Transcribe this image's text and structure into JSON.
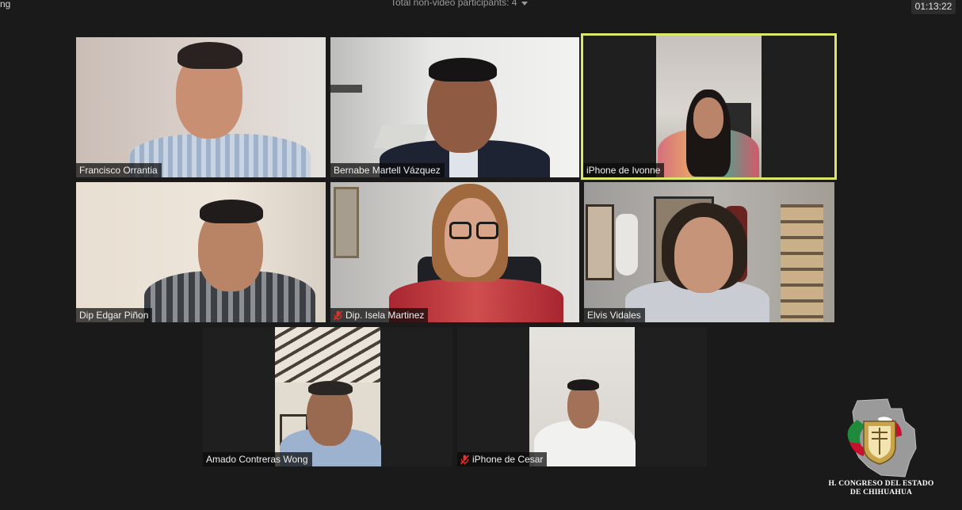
{
  "header": {
    "corner_text": "ng",
    "non_video_participants": "Total non-video participants: 4",
    "elapsed_time": "01:13:22"
  },
  "participants": [
    {
      "name": "Francisco Orrantia",
      "muted": false,
      "active_speaker": false,
      "video": true
    },
    {
      "name": "Bernabe Martell Vázquez",
      "muted": false,
      "active_speaker": false,
      "video": true
    },
    {
      "name": "iPhone de Ivonne",
      "muted": false,
      "active_speaker": true,
      "video": true
    },
    {
      "name": "Dip Edgar Piñon",
      "muted": false,
      "active_speaker": false,
      "video": true
    },
    {
      "name": "Dip. Isela Martinez",
      "muted": true,
      "active_speaker": false,
      "video": true
    },
    {
      "name": "Elvis Vidales",
      "muted": false,
      "active_speaker": false,
      "video": true
    },
    {
      "name": "Amado Contreras Wong",
      "muted": false,
      "active_speaker": false,
      "video": true
    },
    {
      "name": "iPhone de Cesar",
      "muted": true,
      "active_speaker": false,
      "video": true
    }
  ],
  "logo": {
    "line1": "H. CONGRESO DEL ESTADO",
    "line2": "DE CHIHUAHUA",
    "colors": {
      "green": "#1f8a3b",
      "white": "#ffffff",
      "red": "#c8102e",
      "gold": "#c9a44a"
    }
  },
  "colors": {
    "background": "#1a1a1a",
    "active_speaker_border": "#dbe86a",
    "mute_red": "#e0332e"
  }
}
